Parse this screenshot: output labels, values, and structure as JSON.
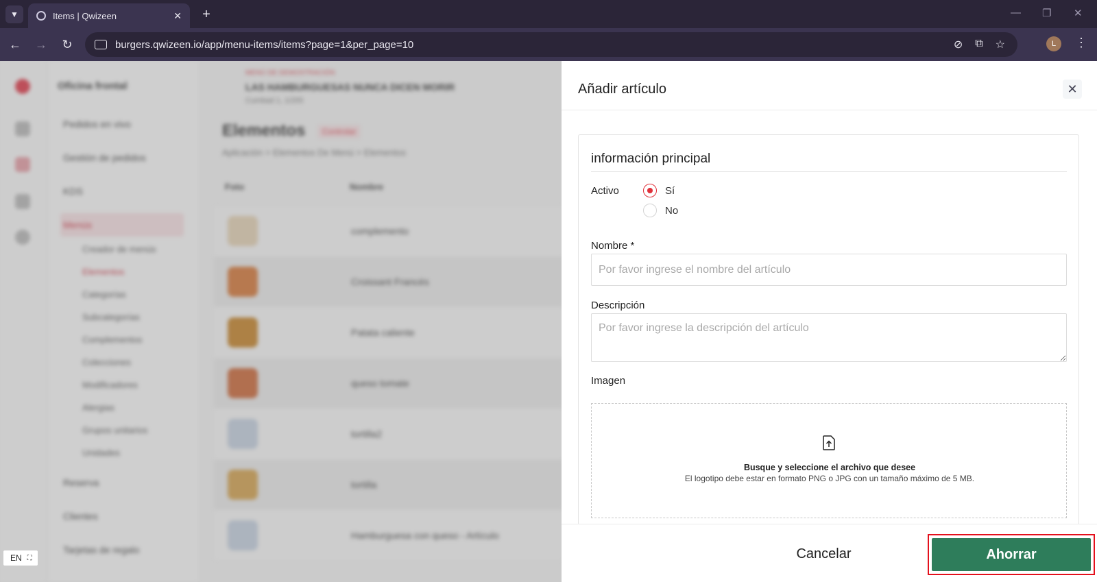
{
  "browser": {
    "tab_title": "Items | Qwizeen",
    "url": "burgers.qwizeen.io/app/menu-items/items?page=1&per_page=10",
    "profile_initial": "L",
    "lang": "EN"
  },
  "background": {
    "sidebar_title": "Oficina frontal",
    "nav": [
      "Pedidos en vivo",
      "Gestión de pedidos",
      "KDS",
      "Menús",
      "Reserva",
      "Clientes",
      "Tarjetas de regalo"
    ],
    "menu_sub": [
      "Creador de menús",
      "Elementos",
      "Categorías",
      "Subcategorías",
      "Complementos",
      "Colecciones",
      "Modificadores",
      "Alergias",
      "Grupos unitarios",
      "Unidades"
    ],
    "restaurant_tag": "MENÚ DE DEMOSTRACIÓN",
    "restaurant_name": "LAS HAMBURGUESAS NUNCA DICEN MORIR",
    "restaurant_sub": "Cumbad 1, 1/255",
    "page_title": "Elementos",
    "page_badge": "Controlar",
    "breadcrumb": "Aplicación  >  Elementos De Menú  >  Elementos",
    "col_photo": "Foto",
    "col_name": "Nombre",
    "rows": [
      "complemento",
      "Croissant Francés",
      "Patata caliente",
      "queso tomate",
      "tortilla2",
      "tortilla",
      "Hamburguesa con queso - Artículo"
    ]
  },
  "drawer": {
    "title": "Añadir artículo",
    "section_title": "información principal",
    "active_label": "Activo",
    "active_yes": "Sí",
    "active_no": "No",
    "name_label": "Nombre *",
    "name_placeholder": "Por favor ingrese el nombre del artículo",
    "description_label": "Descripción",
    "description_placeholder": "Por favor ingrese la descripción del artículo",
    "image_label": "Imagen",
    "upload_main": "Busque y seleccione el archivo que desee",
    "upload_sub": "El logotipo debe estar en formato PNG o JPG con un tamaño máximo de 5 MB.",
    "cancel_label": "Cancelar",
    "save_label": "Ahorrar"
  },
  "colors": {
    "accent": "#e0303a",
    "save": "#2e7d5b",
    "highlight": "#e4101c"
  }
}
